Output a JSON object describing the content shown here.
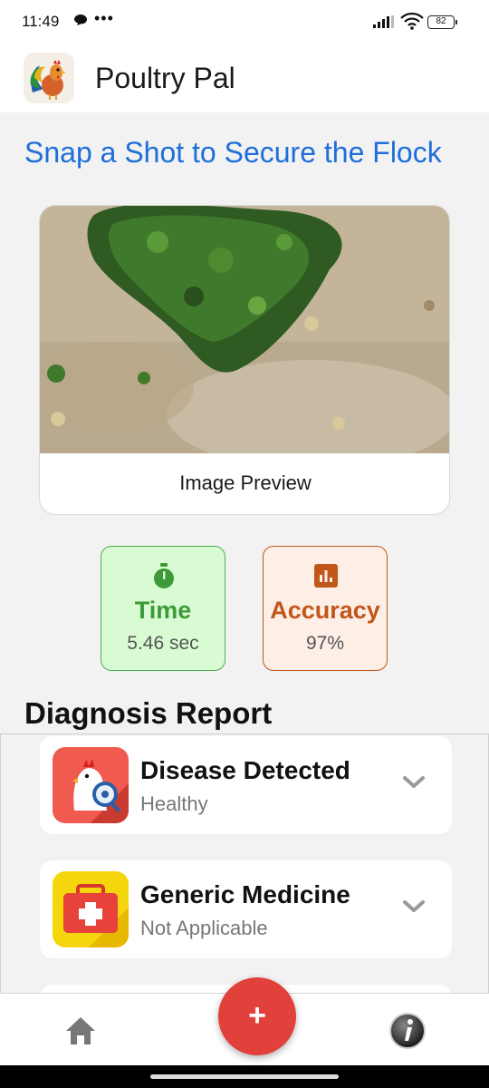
{
  "status_bar": {
    "time": "11:49",
    "dots": "•••",
    "battery": "82",
    "icons": [
      "chat-bubble-icon",
      "signal-icon",
      "wifi-icon",
      "battery-icon"
    ]
  },
  "header": {
    "title": "Poultry Pal",
    "logo": "rooster-logo"
  },
  "headline": "Snap a Shot to Secure the Flock",
  "preview": {
    "label": "Image Preview"
  },
  "stats": {
    "time": {
      "label": "Time",
      "value": "5.46 sec",
      "icon": "stopwatch-icon",
      "color": "#3d9a36"
    },
    "accuracy": {
      "label": "Accuracy",
      "value": "97%",
      "icon": "bar-chart-icon",
      "color": "#c0561a"
    }
  },
  "report": {
    "title": "Diagnosis Report",
    "items": [
      {
        "title": "Disease Detected",
        "subtitle": "Healthy",
        "icon": "sick-chicken-icon"
      },
      {
        "title": "Generic Medicine",
        "subtitle": "Not Applicable",
        "icon": "medical-kit-icon"
      }
    ]
  },
  "nav": {
    "home_icon": "home-icon",
    "fab_label": "+",
    "info_icon": "info-icon"
  },
  "colors": {
    "accent_blue": "#1e6fd9",
    "fab_red": "#e2403b",
    "time_green": "#d9fbd4",
    "accuracy_orange": "#fdeee6"
  }
}
